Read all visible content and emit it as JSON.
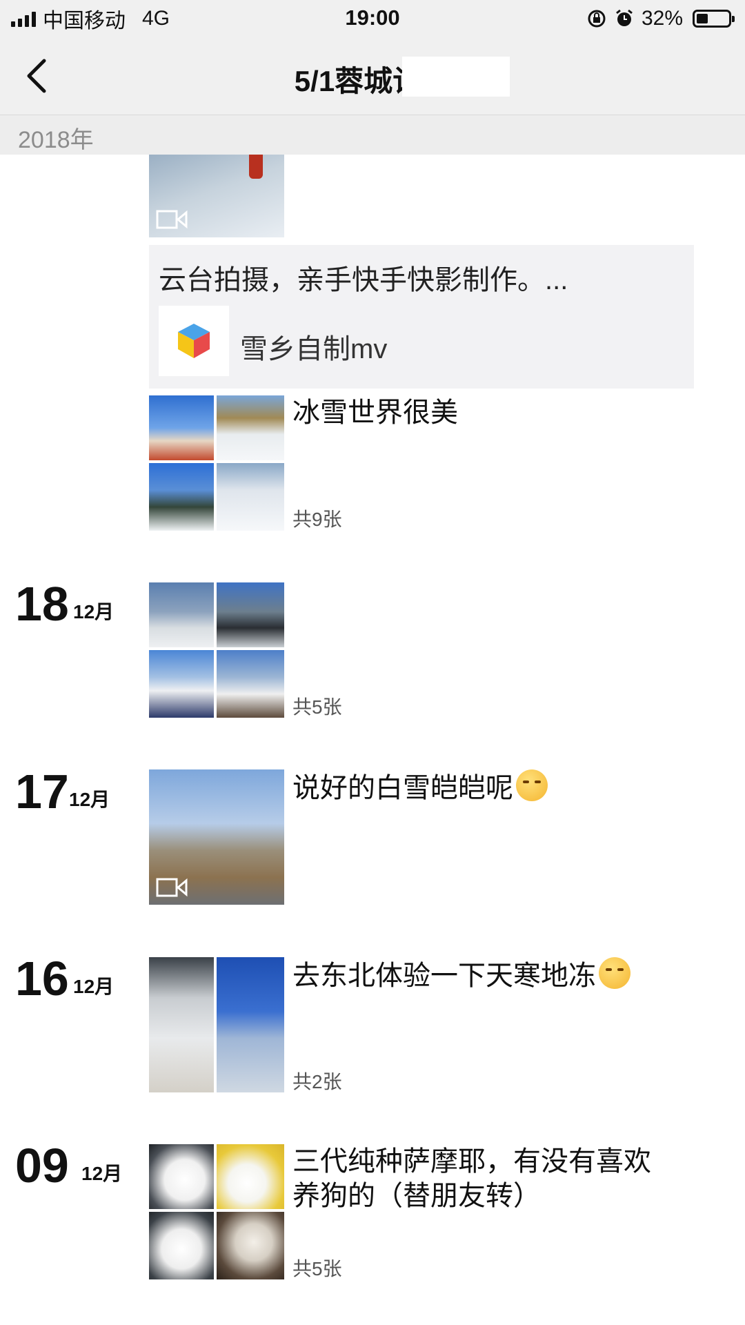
{
  "status_bar": {
    "carrier": "中国移动",
    "network": "4G",
    "time": "19:00",
    "battery": "32%"
  },
  "nav": {
    "title": "5/1蓉城计划"
  },
  "year_header": "2018年",
  "entries": [
    {
      "text": "",
      "media": "video"
    },
    {
      "share": {
        "desc": "云台拍摄，亲手快手快影制作。...",
        "title": "雪乡自制mv",
        "icon": "cube-app-icon"
      }
    },
    {
      "text": "冰雪世界很美",
      "count": "共9张"
    },
    {
      "day": "18",
      "month": "12月",
      "text": "",
      "count": "共5张"
    },
    {
      "day": "17",
      "month": "12月",
      "text": "说好的白雪皑皑呢",
      "emoji": "blushing-face-emoji",
      "media": "video"
    },
    {
      "day": "16",
      "month": "12月",
      "text": "去东北体验一下天寒地冻",
      "emoji": "smirking-face-emoji",
      "count": "共2张"
    },
    {
      "day": "09",
      "month": "12月",
      "text_line1": "三代纯种萨摩耶，有没有喜欢",
      "text_line2": "养狗的（替朋友转）",
      "count": "共5张"
    }
  ],
  "colors": {
    "bar_bg": "#f0f0f0",
    "year_bg": "#ededed",
    "card_bg": "#f2f2f4"
  }
}
